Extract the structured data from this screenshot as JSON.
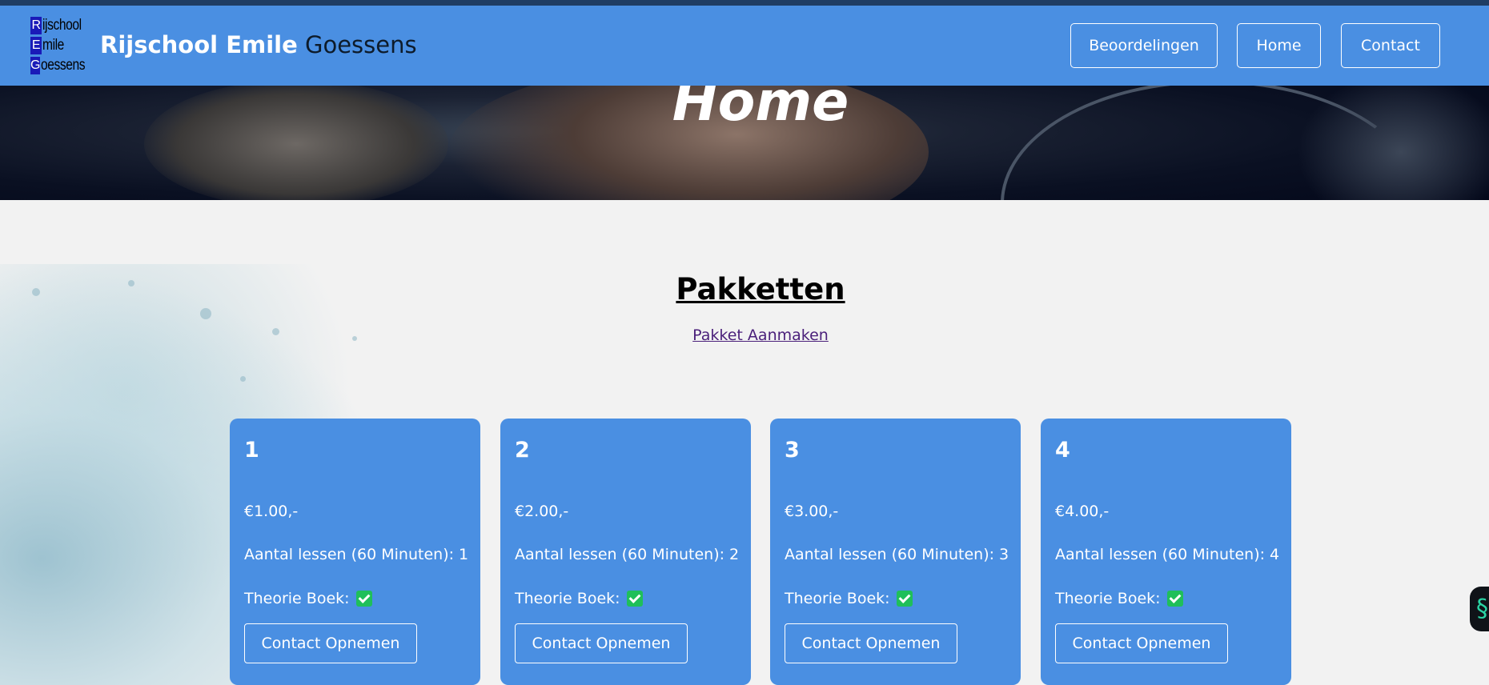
{
  "header": {
    "logo_letters": [
      "R",
      "E",
      "G"
    ],
    "logo_rest": [
      "ijschool",
      "mile",
      "oessens"
    ],
    "brand_bold": "Rijschool Emile",
    "brand_light": "Goessens",
    "nav": [
      "Beoordelingen",
      "Home",
      "Contact"
    ]
  },
  "hero": {
    "title": "Home"
  },
  "main": {
    "title": "Pakketten",
    "create_link": "Pakket Aanmaken",
    "cards": [
      {
        "name": "1",
        "price": "€1.00,-",
        "lessons": "Aantal lessen (60 Minuten): 1",
        "theory": "Theorie Boek:",
        "button": "Contact Opnemen"
      },
      {
        "name": "2",
        "price": "€2.00,-",
        "lessons": "Aantal lessen (60 Minuten): 2",
        "theory": "Theorie Boek:",
        "button": "Contact Opnemen"
      },
      {
        "name": "3",
        "price": "€3.00,-",
        "lessons": "Aantal lessen (60 Minuten): 3",
        "theory": "Theorie Boek:",
        "button": "Contact Opnemen"
      },
      {
        "name": "4",
        "price": "€4.00,-",
        "lessons": "Aantal lessen (60 Minuten): 4",
        "theory": "Theorie Boek:",
        "button": "Contact Opnemen"
      }
    ]
  },
  "icons": {
    "theory_included": "check-icon",
    "side_widget": "chat-widget-icon"
  },
  "colors": {
    "primary": "#4a8fe2",
    "check": "#1fbf5a",
    "link": "#4a1f7a"
  }
}
